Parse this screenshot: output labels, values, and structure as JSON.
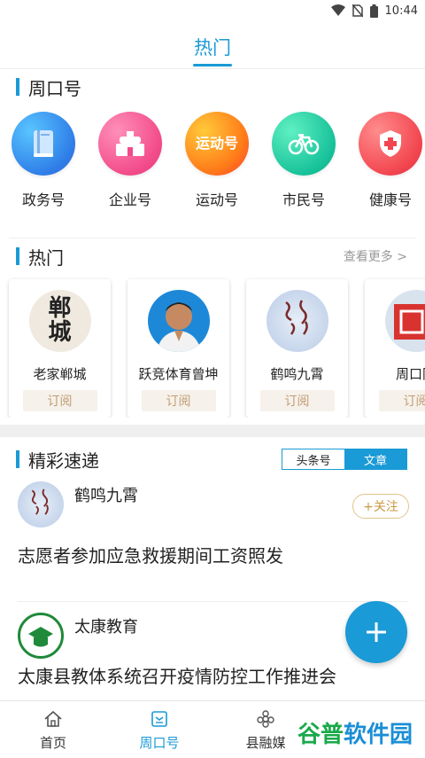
{
  "status_bar": {
    "time": "10:44"
  },
  "top_tabs": {
    "active": "热门"
  },
  "weekly": {
    "title": "周口号",
    "items": [
      {
        "label": "政务号",
        "icon": "book-icon"
      },
      {
        "label": "企业号",
        "icon": "building-icon"
      },
      {
        "label": "运动号",
        "icon": "sport-logo-icon",
        "logo_text": "运动号"
      },
      {
        "label": "市民号",
        "icon": "bicycle-icon"
      },
      {
        "label": "健康号",
        "icon": "shield-cross-icon"
      }
    ]
  },
  "hot": {
    "title": "热门",
    "more": "查看更多 >",
    "cards": [
      {
        "name": "老家郸城",
        "action": "订阅",
        "avatar_text": "郸城"
      },
      {
        "name": "跃竞体育曾坤",
        "action": "订阅"
      },
      {
        "name": "鹤鸣九霄",
        "action": "订阅"
      },
      {
        "name": "周口同",
        "action": "订阅"
      }
    ]
  },
  "feed": {
    "title": "精彩速递",
    "segments": [
      "头条号",
      "文章"
    ],
    "active_segment": "文章",
    "posts": [
      {
        "author": "鹤鸣九霄",
        "follow": "+关注",
        "title": "志愿者参加应急救援期间工资照发"
      },
      {
        "author": "太康教育",
        "title": "太康县教体系统召开疫情防控工作推进会"
      }
    ]
  },
  "bottom_nav": {
    "items": [
      {
        "label": "首页",
        "icon": "home-icon"
      },
      {
        "label": "周口号",
        "icon": "news-icon"
      },
      {
        "label": "县融媒",
        "icon": "flower-icon"
      }
    ],
    "active": "周口号"
  },
  "watermark": {
    "a": "谷普",
    "b": "软件园"
  },
  "colors": {
    "accent": "#1a9ad6",
    "subscribe_text": "#c09d75"
  }
}
